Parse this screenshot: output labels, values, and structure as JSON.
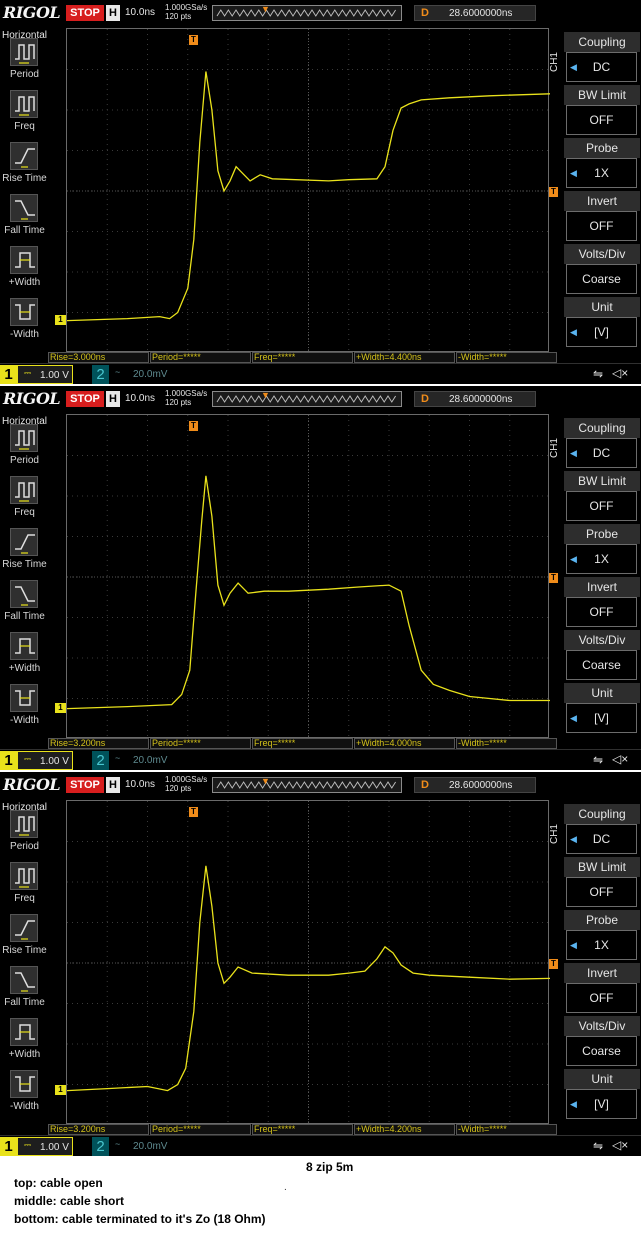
{
  "scopes": [
    {
      "brand": "RIGOL",
      "run_state": "STOP",
      "h_label": "H",
      "timebase": "10.0ns",
      "sample_rate": "1.000GSa/s",
      "points": "120  pts",
      "delay_label": "D",
      "delay": "28.6000000ns",
      "trigger_label": "T",
      "trigger_channel": "1",
      "trigger_level": "3.16 V",
      "left_menu_title": "Horizontal",
      "left_menu": [
        {
          "label": "Period",
          "icon": "period-icon"
        },
        {
          "label": "Freq",
          "icon": "freq-icon"
        },
        {
          "label": "Rise Time",
          "icon": "rise-time-icon"
        },
        {
          "label": "Fall Time",
          "icon": "fall-time-icon"
        },
        {
          "label": "+Width",
          "icon": "positive-width-icon"
        },
        {
          "label": "-Width",
          "icon": "negative-width-icon"
        }
      ],
      "channel_label": "CH1",
      "right_menu": [
        {
          "title": "Coupling",
          "value": "DC",
          "arrow": true
        },
        {
          "title": "BW Limit",
          "value": "OFF",
          "arrow": false
        },
        {
          "title": "Probe",
          "value": "1X",
          "arrow": true
        },
        {
          "title": "Invert",
          "value": "OFF",
          "arrow": false
        },
        {
          "title": "Volts/Div",
          "value": "Coarse",
          "arrow": false
        },
        {
          "title": "Unit",
          "value": "[V]",
          "arrow": true
        }
      ],
      "measurements": [
        "Rise=3.000ns",
        "Period=*****",
        "Freq=*****",
        "+Width=4.400ns",
        "-Width=*****"
      ],
      "ch1_num": "1",
      "ch1_coupling": "⎓",
      "ch1_scale": "1.00 V",
      "ch2_num": "2",
      "ch2_coupling": "~",
      "ch2_scale": "20.0mV",
      "trace_color": "#e9e21b",
      "waveform": {
        "units": "divisions (x: 0-12, y: 0-8 from top)",
        "points": [
          [
            0,
            7.2
          ],
          [
            1.5,
            7.15
          ],
          [
            2.3,
            7.1
          ],
          [
            2.55,
            7.15
          ],
          [
            2.75,
            7.0
          ],
          [
            3.0,
            6.4
          ],
          [
            3.15,
            5.2
          ],
          [
            3.3,
            2.8
          ],
          [
            3.45,
            1.05
          ],
          [
            3.6,
            2.0
          ],
          [
            3.75,
            3.5
          ],
          [
            3.9,
            4.0
          ],
          [
            4.05,
            3.75
          ],
          [
            4.2,
            3.4
          ],
          [
            4.35,
            3.55
          ],
          [
            4.55,
            3.75
          ],
          [
            4.8,
            3.6
          ],
          [
            5.1,
            3.7
          ],
          [
            6.5,
            3.75
          ],
          [
            7.0,
            3.72
          ],
          [
            7.7,
            3.7
          ],
          [
            7.9,
            3.4
          ],
          [
            8.1,
            2.5
          ],
          [
            8.3,
            1.95
          ],
          [
            8.5,
            1.85
          ],
          [
            8.8,
            1.75
          ],
          [
            9.5,
            1.7
          ],
          [
            10.5,
            1.65
          ],
          [
            12,
            1.6
          ]
        ],
        "ch1_level_div": 7.2,
        "trigger_level_div": 4.05
      }
    },
    {
      "brand": "RIGOL",
      "run_state": "STOP",
      "h_label": "H",
      "timebase": "10.0ns",
      "sample_rate": "1.000GSa/s",
      "points": "120  pts",
      "delay_label": "D",
      "delay": "28.6000000ns",
      "trigger_label": "T",
      "trigger_channel": "1",
      "trigger_level": "3.16 V",
      "left_menu_title": "Horizontal",
      "left_menu": [
        {
          "label": "Period",
          "icon": "period-icon"
        },
        {
          "label": "Freq",
          "icon": "freq-icon"
        },
        {
          "label": "Rise Time",
          "icon": "rise-time-icon"
        },
        {
          "label": "Fall Time",
          "icon": "fall-time-icon"
        },
        {
          "label": "+Width",
          "icon": "positive-width-icon"
        },
        {
          "label": "-Width",
          "icon": "negative-width-icon"
        }
      ],
      "channel_label": "CH1",
      "right_menu": [
        {
          "title": "Coupling",
          "value": "DC",
          "arrow": true
        },
        {
          "title": "BW Limit",
          "value": "OFF",
          "arrow": false
        },
        {
          "title": "Probe",
          "value": "1X",
          "arrow": true
        },
        {
          "title": "Invert",
          "value": "OFF",
          "arrow": false
        },
        {
          "title": "Volts/Div",
          "value": "Coarse",
          "arrow": false
        },
        {
          "title": "Unit",
          "value": "[V]",
          "arrow": true
        }
      ],
      "measurements": [
        "Rise=3.200ns",
        "Period=*****",
        "Freq=*****",
        "+Width=4.000ns",
        "-Width=*****"
      ],
      "ch1_num": "1",
      "ch1_coupling": "⎓",
      "ch1_scale": "1.00 V",
      "ch2_num": "2",
      "ch2_coupling": "~",
      "ch2_scale": "20.0mV",
      "trace_color": "#e9e21b",
      "waveform": {
        "units": "divisions (x: 0-12, y: 0-8 from top)",
        "points": [
          [
            0,
            7.25
          ],
          [
            1.5,
            7.2
          ],
          [
            2.6,
            7.15
          ],
          [
            2.85,
            6.9
          ],
          [
            3.05,
            6.3
          ],
          [
            3.2,
            4.4
          ],
          [
            3.35,
            2.6
          ],
          [
            3.45,
            1.5
          ],
          [
            3.6,
            2.5
          ],
          [
            3.75,
            4.2
          ],
          [
            3.9,
            4.7
          ],
          [
            4.05,
            4.4
          ],
          [
            4.25,
            4.15
          ],
          [
            4.5,
            4.4
          ],
          [
            4.9,
            4.35
          ],
          [
            5.5,
            4.35
          ],
          [
            6.5,
            4.3
          ],
          [
            7.2,
            4.25
          ],
          [
            8.0,
            4.2
          ],
          [
            8.3,
            4.35
          ],
          [
            8.5,
            5.2
          ],
          [
            8.8,
            6.3
          ],
          [
            9.1,
            6.65
          ],
          [
            9.5,
            6.8
          ],
          [
            10.0,
            6.95
          ],
          [
            10.5,
            7.0
          ],
          [
            11.0,
            7.05
          ],
          [
            12,
            7.05
          ]
        ],
        "ch1_level_div": 7.25,
        "trigger_level_div": 4.05
      }
    },
    {
      "brand": "RIGOL",
      "run_state": "STOP",
      "h_label": "H",
      "timebase": "10.0ns",
      "sample_rate": "1.000GSa/s",
      "points": "120  pts",
      "delay_label": "D",
      "delay": "28.6000000ns",
      "trigger_label": "T",
      "trigger_channel": "1",
      "trigger_level": "3.16 V",
      "left_menu_title": "Horizontal",
      "left_menu": [
        {
          "label": "Period",
          "icon": "period-icon"
        },
        {
          "label": "Freq",
          "icon": "freq-icon"
        },
        {
          "label": "Rise Time",
          "icon": "rise-time-icon"
        },
        {
          "label": "Fall Time",
          "icon": "fall-time-icon"
        },
        {
          "label": "+Width",
          "icon": "positive-width-icon"
        },
        {
          "label": "-Width",
          "icon": "negative-width-icon"
        }
      ],
      "channel_label": "CH1",
      "right_menu": [
        {
          "title": "Coupling",
          "value": "DC",
          "arrow": true
        },
        {
          "title": "BW Limit",
          "value": "OFF",
          "arrow": false
        },
        {
          "title": "Probe",
          "value": "1X",
          "arrow": true
        },
        {
          "title": "Invert",
          "value": "OFF",
          "arrow": false
        },
        {
          "title": "Volts/Div",
          "value": "Coarse",
          "arrow": false
        },
        {
          "title": "Unit",
          "value": "[V]",
          "arrow": true
        }
      ],
      "measurements": [
        "Rise=3.200ns",
        "Period=*****",
        "Freq=*****",
        "+Width=4.200ns",
        "-Width=*****"
      ],
      "ch1_num": "1",
      "ch1_coupling": "⎓",
      "ch1_scale": "1.00 V",
      "ch2_num": "2",
      "ch2_coupling": "~",
      "ch2_scale": "20.0mV",
      "trace_color": "#e9e21b",
      "waveform": {
        "units": "divisions (x: 0-12, y: 0-8 from top)",
        "points": [
          [
            0,
            7.15
          ],
          [
            1.0,
            7.1
          ],
          [
            2.0,
            7.05
          ],
          [
            2.5,
            7.15
          ],
          [
            2.75,
            7.0
          ],
          [
            2.95,
            6.6
          ],
          [
            3.15,
            5.2
          ],
          [
            3.3,
            3.0
          ],
          [
            3.45,
            1.6
          ],
          [
            3.6,
            2.6
          ],
          [
            3.75,
            4.0
          ],
          [
            3.9,
            4.5
          ],
          [
            4.05,
            4.35
          ],
          [
            4.25,
            4.1
          ],
          [
            4.6,
            4.25
          ],
          [
            5.5,
            4.3
          ],
          [
            6.5,
            4.3
          ],
          [
            7.0,
            4.25
          ],
          [
            7.4,
            4.2
          ],
          [
            7.7,
            3.9
          ],
          [
            7.9,
            3.6
          ],
          [
            8.1,
            3.75
          ],
          [
            8.3,
            4.05
          ],
          [
            8.6,
            4.25
          ],
          [
            9.0,
            4.3
          ],
          [
            10.0,
            4.35
          ],
          [
            11.0,
            4.4
          ],
          [
            12,
            4.38
          ]
        ],
        "ch1_level_div": 7.15,
        "trigger_level_div": 4.05
      }
    }
  ],
  "caption": {
    "title": "8 zip 5m",
    "lines": [
      "top: cable open",
      "middle: cable short",
      "bottom: cable terminated to it's Zo (18 Ohm)"
    ],
    "dot": "."
  }
}
